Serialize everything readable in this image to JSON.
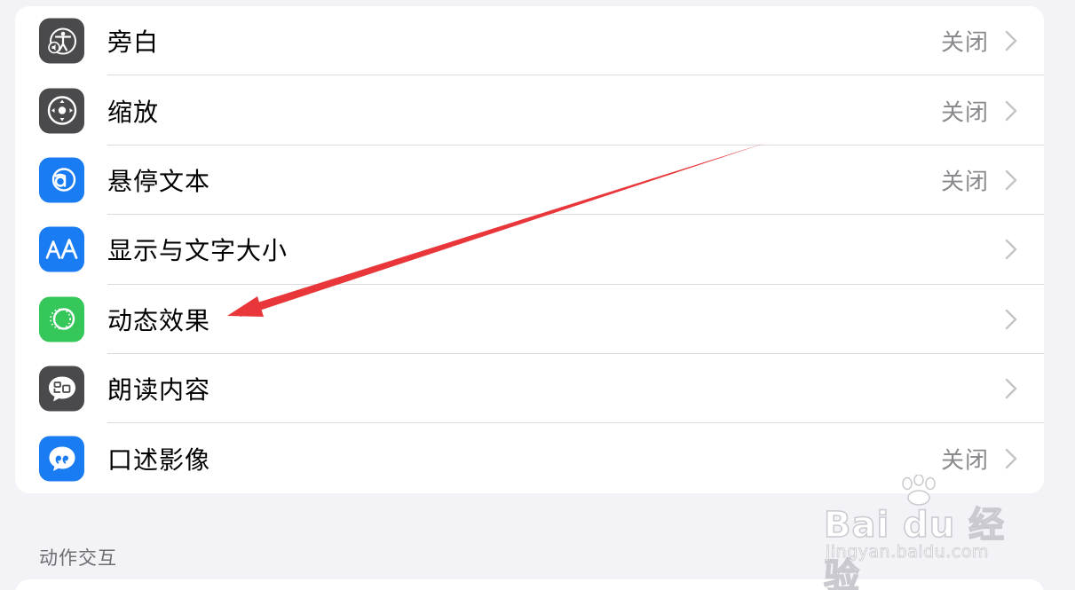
{
  "settings": {
    "items": [
      {
        "label": "旁白",
        "value": "关闭",
        "icon": "voiceover-icon",
        "icon_color": "#4a4a4c"
      },
      {
        "label": "缩放",
        "value": "关闭",
        "icon": "zoom-icon",
        "icon_color": "#4a4a4c"
      },
      {
        "label": "悬停文本",
        "value": "关闭",
        "icon": "hover-text-icon",
        "icon_color": "#1a7cf2"
      },
      {
        "label": "显示与文字大小",
        "value": "",
        "icon": "text-size-icon",
        "icon_color": "#1a7cf2"
      },
      {
        "label": "动态效果",
        "value": "",
        "icon": "motion-icon",
        "icon_color": "#35c759"
      },
      {
        "label": "朗读内容",
        "value": "",
        "icon": "spoken-content-icon",
        "icon_color": "#4a4a4c"
      },
      {
        "label": "口述影像",
        "value": "关闭",
        "icon": "audio-description-icon",
        "icon_color": "#1a7cf2"
      }
    ]
  },
  "section_header": "动作交互",
  "watermark": {
    "brand": "Bai du 经验",
    "url": "jingyan.baidu.com"
  },
  "annotation": {
    "arrow_color": "#e8363a"
  }
}
